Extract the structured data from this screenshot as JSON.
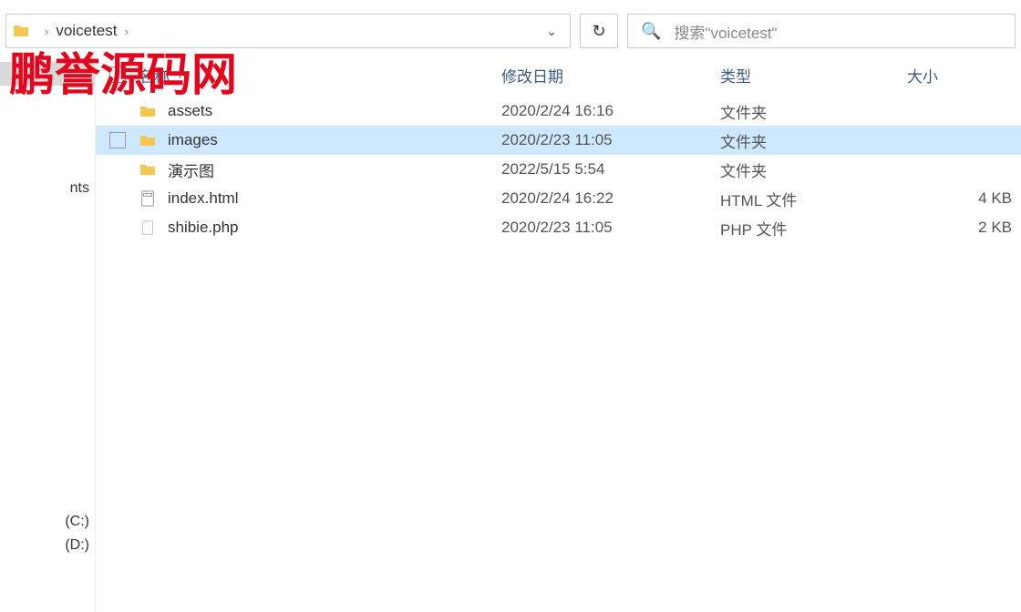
{
  "breadcrumb": {
    "folder_name": "voicetest"
  },
  "search": {
    "placeholder": "搜索\"voicetest\""
  },
  "headers": {
    "name": "名称",
    "date": "修改日期",
    "type": "类型",
    "size": "大小"
  },
  "sidebar": {
    "items": [
      "nts",
      "(C:)",
      "(D:)"
    ]
  },
  "files": [
    {
      "name": "assets",
      "date": "2020/2/24 16:16",
      "type": "文件夹",
      "size": "",
      "kind": "folder",
      "selected": false
    },
    {
      "name": "images",
      "date": "2020/2/23 11:05",
      "type": "文件夹",
      "size": "",
      "kind": "folder",
      "selected": true
    },
    {
      "name": "演示图",
      "date": "2022/5/15 5:54",
      "type": "文件夹",
      "size": "",
      "kind": "folder",
      "selected": false
    },
    {
      "name": "index.html",
      "date": "2020/2/24 16:22",
      "type": "HTML 文件",
      "size": "4 KB",
      "kind": "html",
      "selected": false
    },
    {
      "name": "shibie.php",
      "date": "2020/2/23 11:05",
      "type": "PHP 文件",
      "size": "2 KB",
      "kind": "php",
      "selected": false
    }
  ],
  "watermark": "鹏誉源码网"
}
